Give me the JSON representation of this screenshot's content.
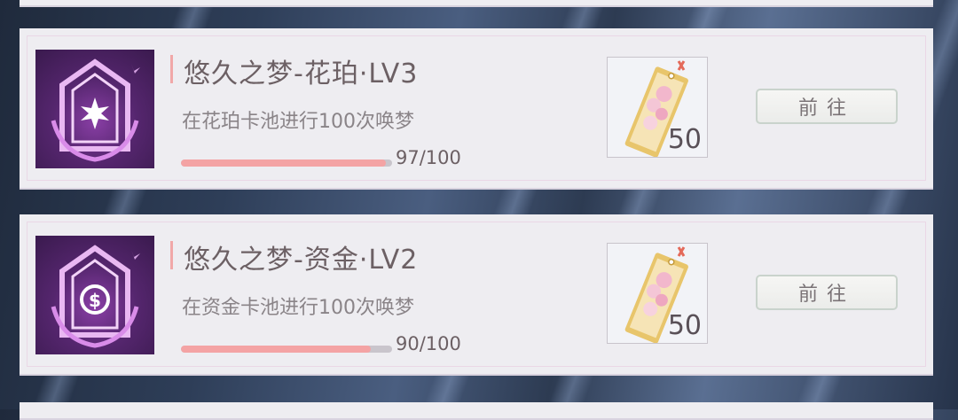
{
  "tasks": [
    {
      "title": "悠久之梦-花珀·LV3",
      "description": "在花珀卡池进行100次唤梦",
      "progress_text": "97/100",
      "progress_fraction": 0.97,
      "badge_icon": "flower-emblem-icon",
      "reward_icon": "dream-ticket-icon",
      "reward_count": "50",
      "button_label": "前往"
    },
    {
      "title": "悠久之梦-资金·LV2",
      "description": "在资金卡池进行100次唤梦",
      "progress_text": "90/100",
      "progress_fraction": 0.9,
      "badge_icon": "coin-emblem-icon",
      "reward_icon": "dream-ticket-icon",
      "reward_count": "50",
      "button_label": "前往"
    }
  ],
  "colors": {
    "progress_fill": "#f4a3a4",
    "progress_track": "#c9c5cc",
    "badge_purple": "#8a3fa6",
    "title_accent": "#f1a8a8"
  }
}
